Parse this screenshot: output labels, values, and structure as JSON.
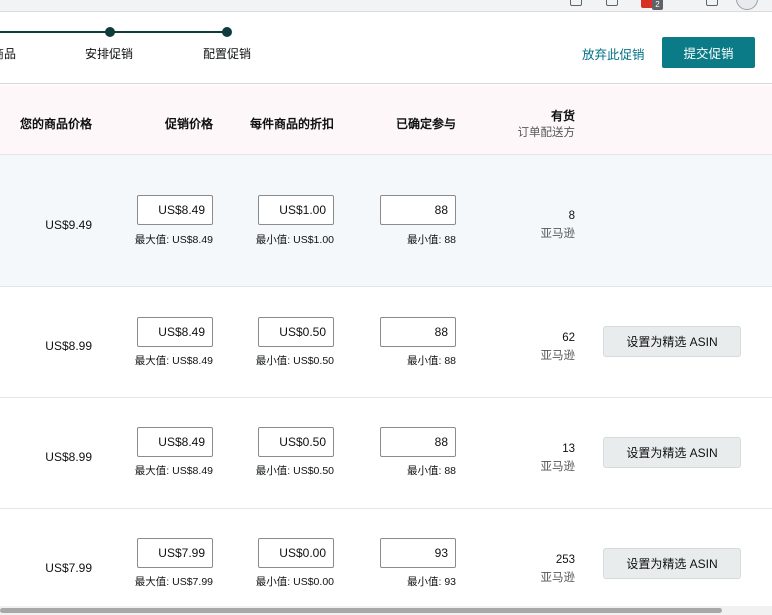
{
  "stepper": {
    "steps": [
      "商品",
      "安排促销",
      "配置促销"
    ]
  },
  "actions": {
    "abandon_label": "放弃此促销",
    "submit_label": "提交促销"
  },
  "browser": {
    "extension_badge": "2"
  },
  "table": {
    "headers": {
      "your_price": "您的商品价格",
      "promo_price": "促销价格",
      "discount_per_unit": "每件商品的折扣",
      "committed": "已确定参与",
      "in_stock": "有货",
      "in_stock_sub": "订单配送方"
    },
    "rows": [
      {
        "your_price": "US$9.49",
        "promo_price": "US$8.49",
        "promo_hint": "最大值: US$8.49",
        "discount": "US$1.00",
        "discount_hint": "最小值: US$1.00",
        "committed": "88",
        "committed_hint": "最小值: 88",
        "stock": "8",
        "fulfillment": "亚马逊",
        "feature_label": ""
      },
      {
        "your_price": "US$8.99",
        "promo_price": "US$8.49",
        "promo_hint": "最大值: US$8.49",
        "discount": "US$0.50",
        "discount_hint": "最小值: US$0.50",
        "committed": "88",
        "committed_hint": "最小值: 88",
        "stock": "62",
        "fulfillment": "亚马逊",
        "feature_label": "设置为精选 ASIN"
      },
      {
        "your_price": "US$8.99",
        "promo_price": "US$8.49",
        "promo_hint": "最大值: US$8.49",
        "discount": "US$0.50",
        "discount_hint": "最小值: US$0.50",
        "committed": "88",
        "committed_hint": "最小值: 88",
        "stock": "13",
        "fulfillment": "亚马逊",
        "feature_label": "设置为精选 ASIN"
      },
      {
        "your_price": "US$7.99",
        "promo_price": "US$7.99",
        "promo_hint": "最大值: US$7.99",
        "discount": "US$0.00",
        "discount_hint": "最小值: US$0.00",
        "committed": "93",
        "committed_hint": "最小值: 93",
        "stock": "253",
        "fulfillment": "亚马逊",
        "feature_label": "设置为精选 ASIN"
      }
    ]
  },
  "colors": {
    "accent": "#0b7b87",
    "link": "#007185",
    "stepper": "#0f3b3e",
    "header_bg": "#fdf7fa",
    "highlight_row_bg": "#f4f8fb"
  }
}
